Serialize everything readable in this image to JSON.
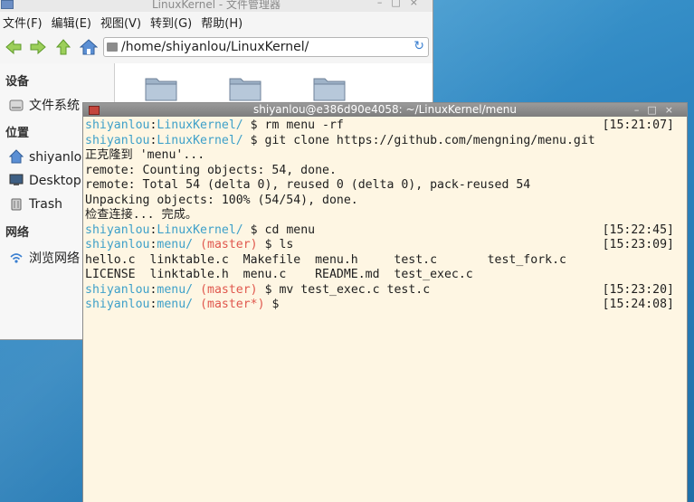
{
  "file_manager": {
    "title": "LinuxKernel - 文件管理器",
    "menu": [
      "文件(F)",
      "编辑(E)",
      "视图(V)",
      "转到(G)",
      "帮助(H)"
    ],
    "address": "/home/shiyanlou/LinuxKernel/",
    "sidebar": {
      "devices_heading": "设备",
      "filesystem": "文件系统",
      "places_heading": "位置",
      "home": "shiyanlou",
      "desktop": "Desktop",
      "trash": "Trash",
      "network_heading": "网络",
      "browse_network": "浏览网络"
    }
  },
  "terminal": {
    "title": "shiyanlou@e386d90e4058: ~/LinuxKernel/menu",
    "lines": [
      {
        "kind": "prompt",
        "user": "shiyanlou",
        "sep": ":",
        "path": "LinuxKernel/",
        "branch": "",
        "cmd": " $ rm menu -rf",
        "time": "[15:21:07]"
      },
      {
        "kind": "prompt",
        "user": "shiyanlou",
        "sep": ":",
        "path": "LinuxKernel/",
        "branch": "",
        "cmd": " $ git clone https://github.com/mengning/menu.git",
        "time": ""
      },
      {
        "kind": "out",
        "text": "正克隆到 'menu'..."
      },
      {
        "kind": "out",
        "text": "remote: Counting objects: 54, done."
      },
      {
        "kind": "out",
        "text": "remote: Total 54 (delta 0), reused 0 (delta 0), pack-reused 54"
      },
      {
        "kind": "out",
        "text": "Unpacking objects: 100% (54/54), done."
      },
      {
        "kind": "out",
        "text": "检查连接... 完成。"
      },
      {
        "kind": "prompt",
        "user": "shiyanlou",
        "sep": ":",
        "path": "LinuxKernel/",
        "branch": "",
        "cmd": " $ cd menu",
        "time": "[15:22:45]"
      },
      {
        "kind": "prompt",
        "user": "shiyanlou",
        "sep": ":",
        "path": "menu/",
        "branch": "master",
        "cmd": " $ ls",
        "time": "[15:23:09]"
      },
      {
        "kind": "out",
        "text": "hello.c  linktable.c  Makefile  menu.h     test.c       test_fork.c"
      },
      {
        "kind": "out",
        "text": "LICENSE  linktable.h  menu.c    README.md  test_exec.c"
      },
      {
        "kind": "prompt",
        "user": "shiyanlou",
        "sep": ":",
        "path": "menu/",
        "branch": "master",
        "cmd": " $ mv test_exec.c test.c",
        "time": "[15:23:20]"
      },
      {
        "kind": "prompt",
        "user": "shiyanlou",
        "sep": ":",
        "path": "menu/",
        "branch": "master*",
        "cmd": " $",
        "time": "[15:24:08]"
      }
    ]
  },
  "colors": {
    "terminal_bg": "#fef6e3",
    "prompt_user": "#3ea0c9",
    "branch": "#e0574d",
    "desktop": "#2f86c0"
  }
}
